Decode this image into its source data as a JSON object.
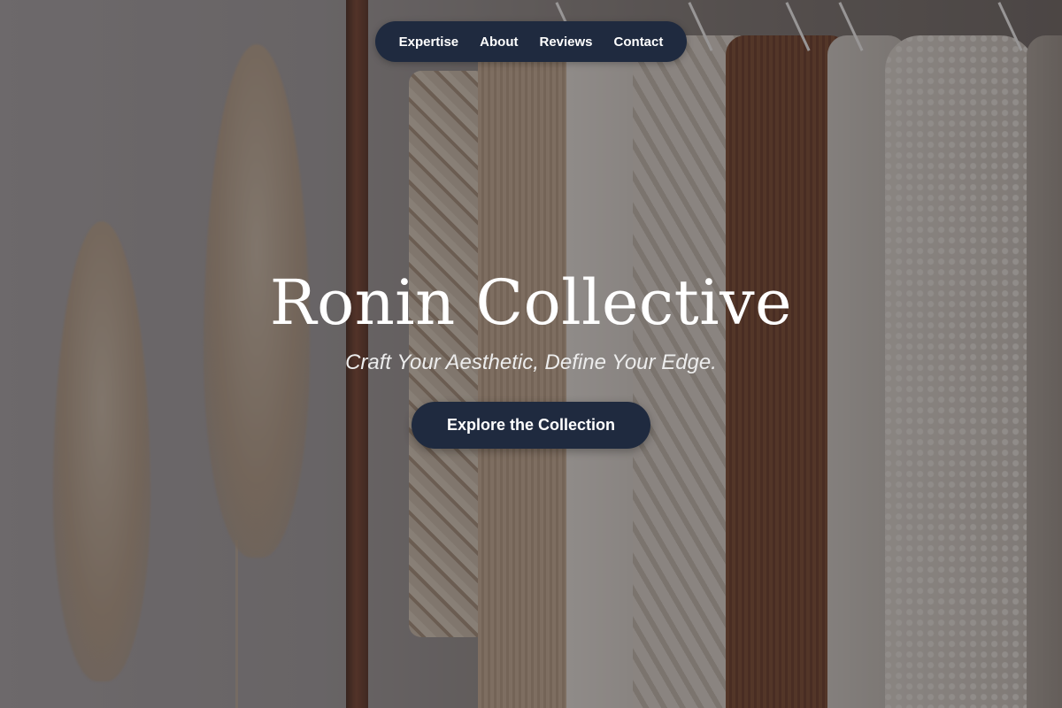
{
  "nav": {
    "items": [
      {
        "label": "Expertise"
      },
      {
        "label": "About"
      },
      {
        "label": "Reviews"
      },
      {
        "label": "Contact"
      }
    ]
  },
  "hero": {
    "title": "Ronin Collective",
    "tagline": "Craft Your Aesthetic, Define Your Edge.",
    "cta_label": "Explore the Collection"
  },
  "colors": {
    "nav_background": "#1f2a3f",
    "cta_background": "#1f2a3f",
    "text": "#ffffff"
  }
}
